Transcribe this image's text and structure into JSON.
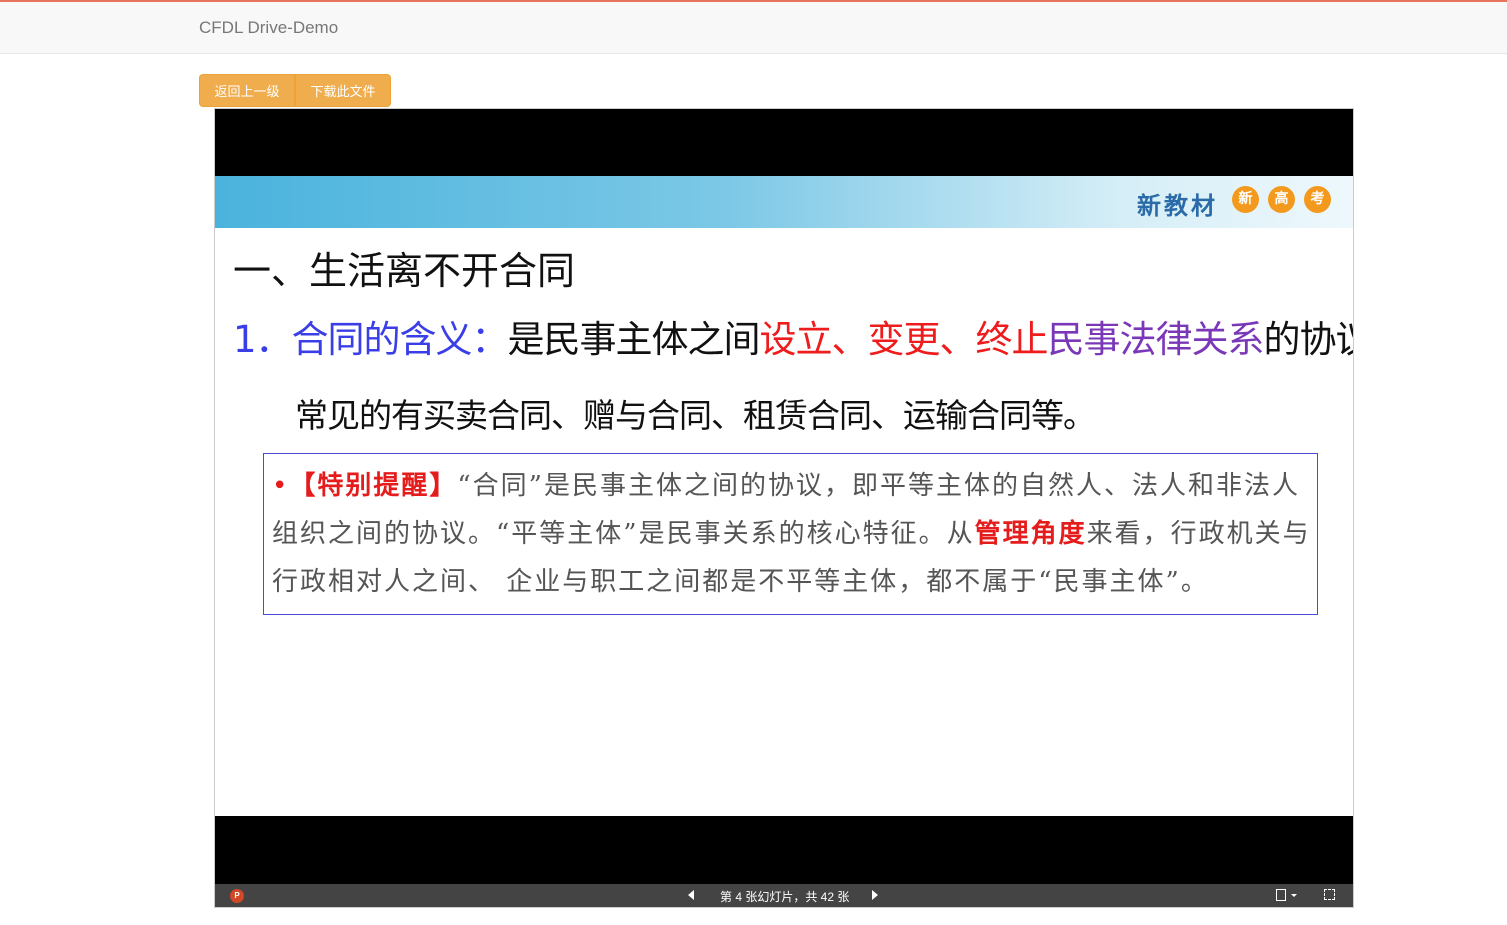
{
  "navbar": {
    "brand": "CFDL Drive-Demo"
  },
  "actions": {
    "back_label": "返回上一级",
    "download_label": "下载此文件"
  },
  "slide": {
    "banner": {
      "text": "新教材",
      "circles": [
        "新",
        "高",
        "考"
      ]
    },
    "heading": "一、生活离不开合同",
    "line1": {
      "num": "1．",
      "term": "合同的含义：",
      "part1": "是民事主体之间",
      "red": "设立、变更、终止",
      "purple": "民事法律关系",
      "end": "的协议。"
    },
    "line2": "常见的有买卖合同、赠与合同、租赁合同、运输合同等。",
    "note": {
      "bullet": "•",
      "tag": "【特别提醒】",
      "text1": "“合同”是民事主体之间的协议，即平等主体的自然人、法人和非法人组织之间的协议。“平等主体”是民事关系的核心特征。从",
      "red": "管理角度",
      "text2": "来看，行政机关与行政相对人之间、 企业与职工之间都是不平等主体，都不属于“民事主体”。"
    }
  },
  "toolbar": {
    "app_icon": "P",
    "page_info": "第 4 张幻灯片，共 42 张",
    "icons": [
      "powerpoint-icon",
      "previous-slide-icon",
      "next-slide-icon",
      "notes-icon",
      "fullscreen-icon"
    ]
  },
  "colors": {
    "button": "#f0ad4e",
    "accent": "#e8745e",
    "toolbar": "#444444"
  }
}
